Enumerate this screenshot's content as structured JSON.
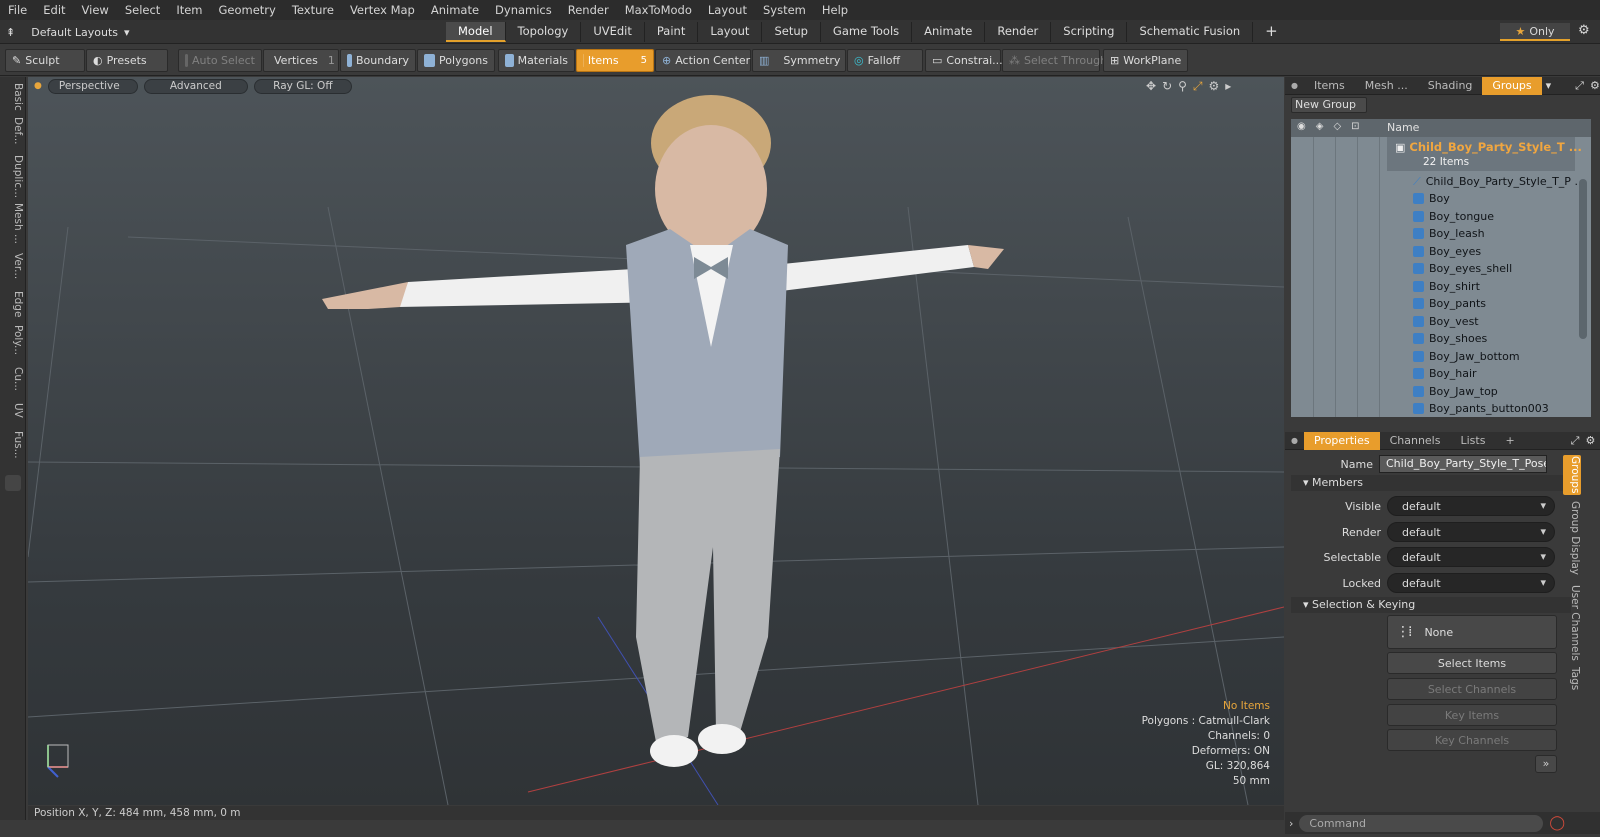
{
  "menu": [
    "File",
    "Edit",
    "View",
    "Select",
    "Item",
    "Geometry",
    "Texture",
    "Vertex Map",
    "Animate",
    "Dynamics",
    "Render",
    "MaxToModo",
    "Layout",
    "System",
    "Help"
  ],
  "layouts": "Default Layouts",
  "mode_tabs": [
    {
      "label": "Model",
      "active": true
    },
    {
      "label": "Topology"
    },
    {
      "label": "UVEdit"
    },
    {
      "label": "Paint"
    },
    {
      "label": "Layout"
    },
    {
      "label": "Setup"
    },
    {
      "label": "Game Tools"
    },
    {
      "label": "Animate"
    },
    {
      "label": "Render"
    },
    {
      "label": "Scripting"
    },
    {
      "label": "Schematic Fusion"
    }
  ],
  "only_label": "Only",
  "toolbar": {
    "sculpt": "Sculpt",
    "presets": "Presets",
    "auto_select": "Auto Select",
    "vertices": "Vertices",
    "vertices_count": "1",
    "boundary": "Boundary",
    "polygons": "Polygons",
    "materials": "Materials",
    "items": "Items",
    "items_count": "5",
    "action_center": "Action Center",
    "symmetry": "Symmetry",
    "falloff": "Falloff",
    "constraints": "Constrai...",
    "select_through": "Select Through",
    "workplane": "WorkPlane"
  },
  "left_tabs": [
    "Basic",
    "Def...",
    "Duplic...",
    "Mesh ...",
    "Ver...",
    "Edge",
    "Poly...",
    "Cu...",
    "UV",
    "Fus..."
  ],
  "viewport": {
    "view": "Perspective",
    "advanced": "Advanced",
    "raygl": "Ray GL: Off",
    "info": {
      "selection": "No Items",
      "polygons": "Polygons : Catmull-Clark",
      "channels": "Channels: 0",
      "deformers": "Deformers: ON",
      "gl": "GL: 320,864",
      "focal": "50 mm"
    }
  },
  "status": "Position X, Y, Z:   484 mm, 458 mm, 0 m",
  "groups_panel": {
    "tabs": [
      "Items",
      "Mesh ...",
      "Shading",
      "Groups"
    ],
    "new_group": "New Group",
    "column_name": "Name",
    "group_name": "Child_Boy_Party_Style_T ...",
    "group_count": "22 Items",
    "items": [
      "Child_Boy_Party_Style_T_P ...",
      "Boy",
      "Boy_tongue",
      "Boy_leash",
      "Boy_eyes",
      "Boy_eyes_shell",
      "Boy_shirt",
      "Boy_pants",
      "Boy_vest",
      "Boy_shoes",
      "Boy_Jaw_bottom",
      "Boy_hair",
      "Boy_Jaw_top",
      "Boy_pants_button003"
    ]
  },
  "properties_panel": {
    "tabs": [
      "Properties",
      "Channels",
      "Lists",
      "+"
    ],
    "name_label": "Name",
    "name_value": "Child_Boy_Party_Style_T_Pose (:",
    "members": "Members",
    "visible_label": "Visible",
    "visible": "default",
    "render_label": "Render",
    "render": "default",
    "selectable_label": "Selectable",
    "selectable": "default",
    "locked_label": "Locked",
    "locked": "default",
    "selection_keying": "Selection & Keying",
    "none": "None",
    "select_items": "Select Items",
    "select_channels": "Select Channels",
    "key_items": "Key Items",
    "key_channels": "Key Channels",
    "side_tabs": [
      "Groups",
      "Group Display",
      "User Channels",
      "Tags"
    ]
  },
  "command_placeholder": "Command"
}
